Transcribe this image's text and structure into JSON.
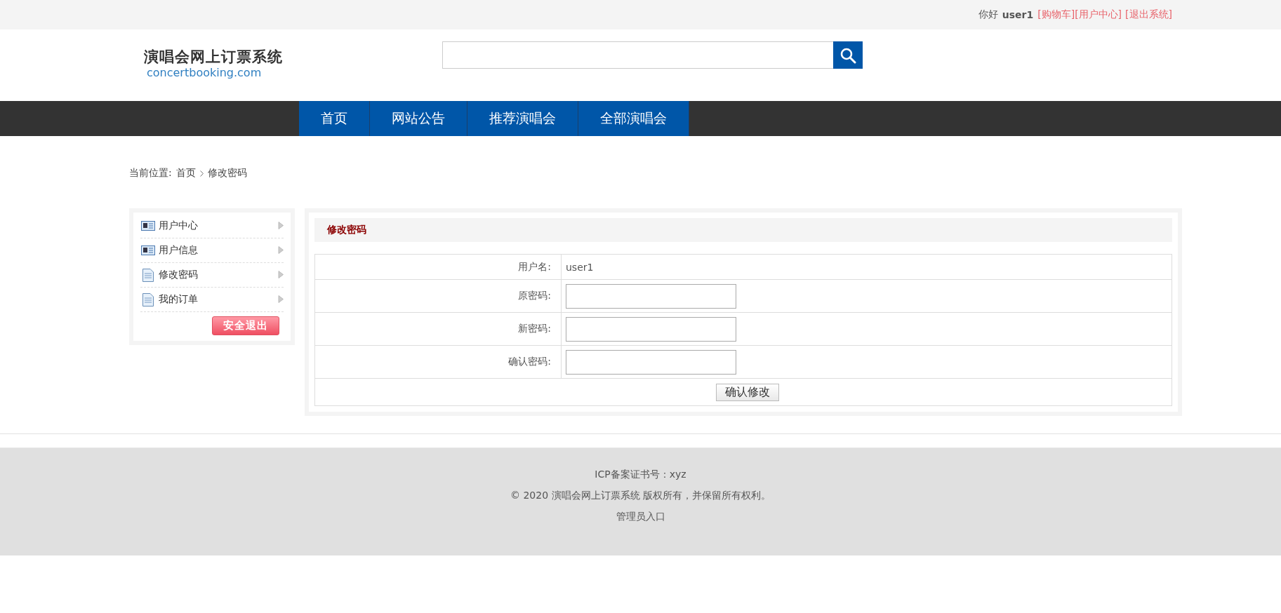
{
  "top_bar": {
    "greeting": "你好",
    "username": "user1",
    "links": [
      "[购物车]",
      "[用户中心]",
      "[退出系统]"
    ]
  },
  "logo": {
    "title": "演唱会网上订票系统",
    "domain": "concertbooking.com"
  },
  "nav": [
    "首页",
    "网站公告",
    "推荐演唱会",
    "全部演唱会"
  ],
  "breadcrumb": {
    "label": "当前位置:",
    "items": [
      "首页",
      "修改密码"
    ]
  },
  "sidebar": {
    "items": [
      {
        "label": "用户中心",
        "kind": "card"
      },
      {
        "label": "用户信息",
        "kind": "card"
      },
      {
        "label": "修改密码",
        "kind": "document"
      },
      {
        "label": "我的订单",
        "kind": "document"
      }
    ],
    "logout_button": "安全退出"
  },
  "panel": {
    "title": "修改密码",
    "rows": [
      {
        "label": "用户名:",
        "kind": "text",
        "value": "user1"
      },
      {
        "label": "原密码:",
        "kind": "password"
      },
      {
        "label": "新密码:",
        "kind": "password"
      },
      {
        "label": "确认密码:",
        "kind": "password"
      }
    ],
    "submit": "确认修改"
  },
  "footer": {
    "lines": [
      "ICP备案证书号：xyz",
      "© 2020 演唱会网上订票系统 版权所有，并保留所有权利。",
      "管理员入口"
    ]
  }
}
